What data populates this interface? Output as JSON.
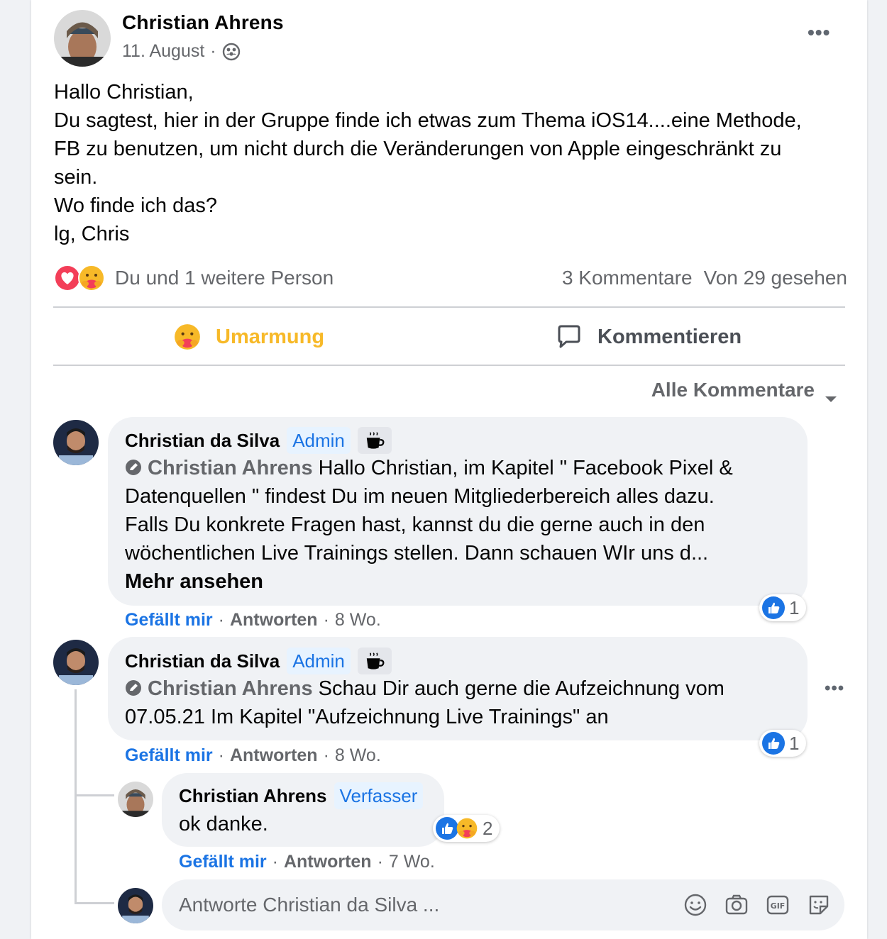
{
  "post": {
    "author": "Christian Ahrens",
    "date": "11. August",
    "audience_icon": "group-icon",
    "lines": [
      "Hallo Christian,",
      "Du sagtest, hier in der Gruppe finde ich etwas zum Thema iOS14....eine Methode,",
      "FB zu benutzen, um nicht durch die Veränderungen von Apple eingeschränkt zu",
      "sein.",
      "Wo finde ich das?",
      "lg, Chris"
    ],
    "reactions_text": "Du und 1 weitere Person",
    "comments_count": "3 Kommentare",
    "seen_by": "Von 29 gesehen"
  },
  "actions": {
    "hug_label": "Umarmung",
    "comment_label": "Kommentieren"
  },
  "filter": {
    "label": "Alle Kommentare"
  },
  "comments": [
    {
      "author": "Christian da Silva",
      "badge": "Admin",
      "mention": "Christian Ahrens",
      "line1": " Hallo Christian, im Kapitel \" Facebook Pixel &",
      "line2": "Datenquellen \" findest Du im neuen Mitgliederbereich alles dazu.",
      "line3": "Falls Du konkrete Fragen hast, kannst du die gerne auch in den",
      "line4": "wöchentlichen Live Trainings stellen. Dann schauen WIr uns d...",
      "more": "Mehr ansehen",
      "like": "Gefällt mir",
      "reply": "Antworten",
      "time": "8 Wo.",
      "reaction_count": "1"
    },
    {
      "author": "Christian da Silva",
      "badge": "Admin",
      "mention": "Christian Ahrens",
      "line1": " Schau Dir auch gerne die Aufzeichnung vom",
      "line2": "07.05.21 Im Kapitel \"Aufzeichnung Live Trainings\" an",
      "like": "Gefällt mir",
      "reply": "Antworten",
      "time": "8 Wo.",
      "reaction_count": "1"
    }
  ],
  "reply": {
    "author": "Christian Ahrens",
    "badge": "Verfasser",
    "text": "ok danke.",
    "like": "Gefällt mir",
    "reply": "Antworten",
    "time": "7 Wo.",
    "reaction_count": "2"
  },
  "reply_input": {
    "placeholder": "Antworte Christian da Silva ..."
  },
  "separator": "·",
  "colors": {
    "accent_blue": "#1b74e4",
    "hug_yellow": "#f7b928",
    "love_red": "#f33e58",
    "secondary_text": "#65676b",
    "bubble_bg": "#f0f2f5"
  }
}
